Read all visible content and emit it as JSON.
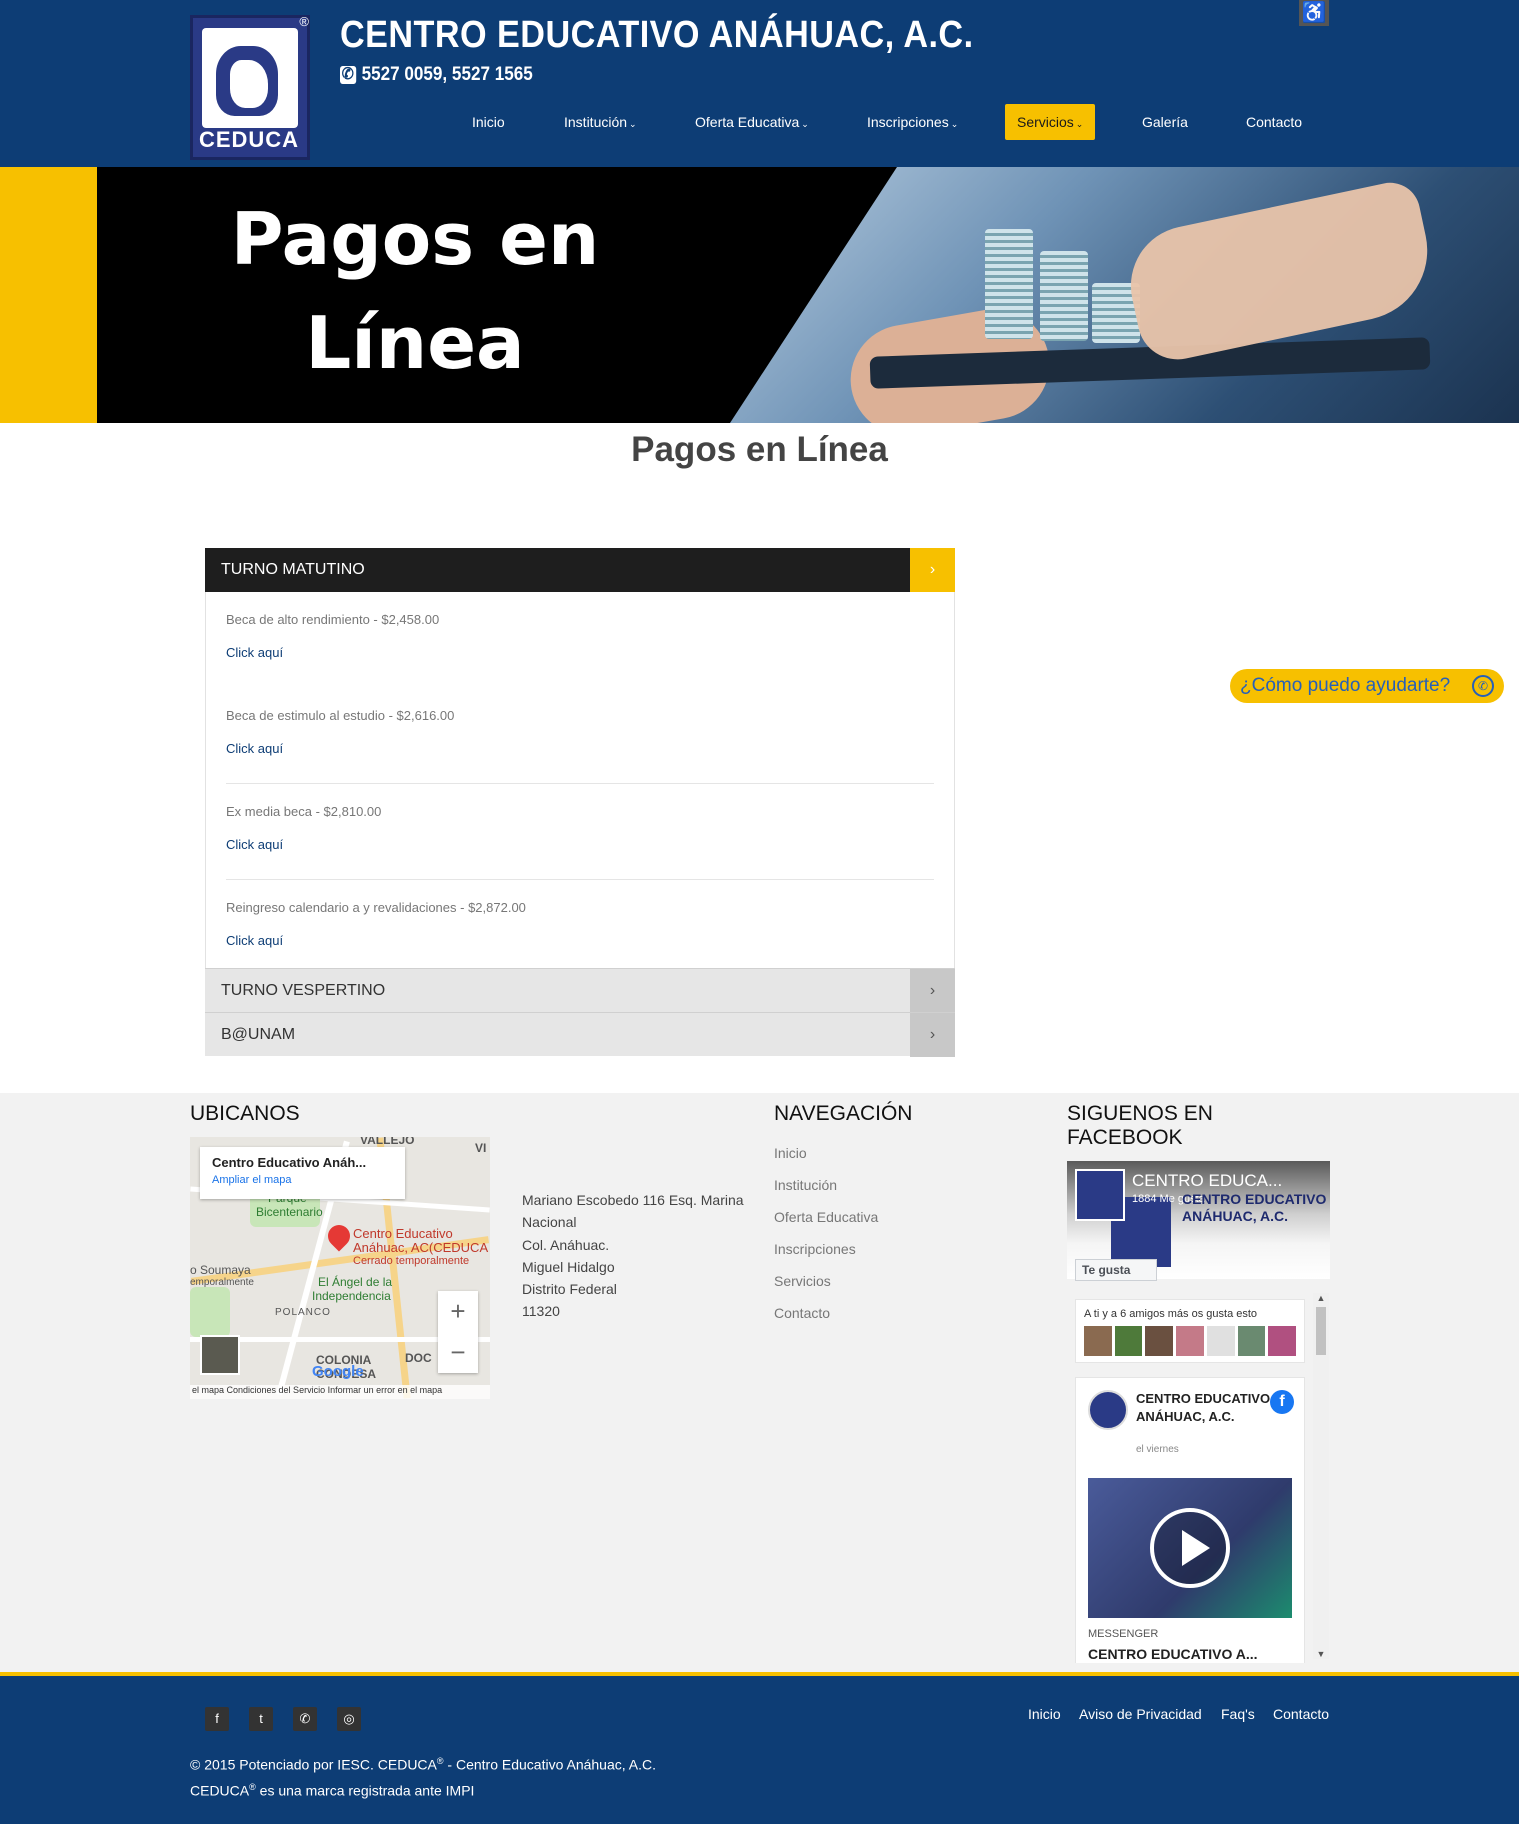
{
  "header": {
    "logo_text": "CEDUCA",
    "logo_reg": "®",
    "title": "CENTRO EDUCATIVO ANÁHUAC, A.C.",
    "phone": "5527 0059, 5527 1565",
    "accessibility_icon": "accessibility-icon"
  },
  "nav": {
    "items": [
      {
        "label": "Inicio",
        "dropdown": false
      },
      {
        "label": "Institución",
        "dropdown": true
      },
      {
        "label": "Oferta Educativa",
        "dropdown": true
      },
      {
        "label": "Inscripciones",
        "dropdown": true
      },
      {
        "label": "Servicios",
        "dropdown": true,
        "active": true
      },
      {
        "label": "Galería",
        "dropdown": false
      },
      {
        "label": "Contacto",
        "dropdown": false
      }
    ],
    "active_color": "#f7c000"
  },
  "banner": {
    "line1": "Pagos en",
    "line2": "Línea"
  },
  "page_title": "Pagos en Línea",
  "accordion": {
    "sections": [
      {
        "title": "TURNO MATUTINO",
        "open": true,
        "items": [
          {
            "desc": "Beca de alto rendimiento - $2,458.00",
            "link": "Click aquí"
          },
          {
            "desc": "Beca de estimulo al estudio - $2,616.00",
            "link": "Click aquí"
          },
          {
            "desc": "Ex media beca - $2,810.00",
            "link": "Click aquí"
          },
          {
            "desc": "Reingreso calendario a y revalidaciones - $2,872.00",
            "link": "Click aquí"
          }
        ]
      },
      {
        "title": "TURNO VESPERTINO",
        "open": false
      },
      {
        "title": "B@UNAM",
        "open": false
      }
    ]
  },
  "whatsapp": {
    "label": "¿Cómo puedo ayudarte?",
    "icon": "whatsapp-icon"
  },
  "footer": {
    "ubicanos": {
      "heading": "UBICANOS",
      "map": {
        "card_title": "Centro Educativo Anáh...",
        "card_link": "Ampliar el mapa",
        "pin_label_1": "Centro Educativo",
        "pin_label_2": "Anáhuac, AC(CEDUCA",
        "pin_sub": "Cerrado temporalmente",
        "labels": [
          "Parque",
          "Bicentenario",
          "o Soumaya",
          "emporalmente",
          "El Ángel de la",
          "Independencia",
          "POLANCO",
          "COLONIA",
          "CONDESA",
          "DOC",
          "VALLEJO",
          "VI"
        ],
        "footer_text": "el mapa   Condiciones del Servicio   Informar un error en el mapa",
        "google": "Google",
        "zoom_in": "+",
        "zoom_out": "−"
      },
      "address": [
        "Mariano Escobedo 116 Esq. Marina Nacional",
        "Col. Anáhuac.",
        "Miguel Hidalgo",
        "Distrito Federal",
        "11320"
      ]
    },
    "navegacion": {
      "heading": "NAVEGACIÓN",
      "links": [
        "Inicio",
        "Institución",
        "Oferta Educativa",
        "Inscripciones",
        "Servicios",
        "Contacto"
      ]
    },
    "facebook": {
      "heading_1": "SIGUENOS EN",
      "heading_2": "FACEBOOK",
      "page_name": "CENTRO EDUCA...",
      "likes": "1884 Me gusta",
      "cover_title": "CENTRO EDUCATIVO ANÁHUAC, A.C.",
      "like_button": "Te gusta",
      "friends_text": "A ti y a 6 amigos más os gusta esto",
      "post_name": "CENTRO EDUCATIVO ANÁHUAC, A.C.",
      "post_date": "el viernes",
      "post_source": "MESSENGER",
      "post_title": "CENTRO EDUCATIVO A..."
    }
  },
  "bottom": {
    "social": [
      "facebook-icon",
      "twitter-icon",
      "whatsapp-icon",
      "instagram-icon"
    ],
    "links": [
      "Inicio",
      "Aviso de Privacidad",
      "Faq's",
      "Contacto"
    ],
    "copyright_1a": "© 2015 Potenciado por IESC. CEDUCA",
    "copyright_1b": " - Centro Educativo Anáhuac, A.C.",
    "copyright_2a": "CEDUCA",
    "copyright_2b": " es una marca registrada ante IMPI",
    "reg": "®"
  },
  "colors": {
    "primary": "#0d3d75",
    "accent": "#f7c000",
    "link": "#0d3d75"
  }
}
